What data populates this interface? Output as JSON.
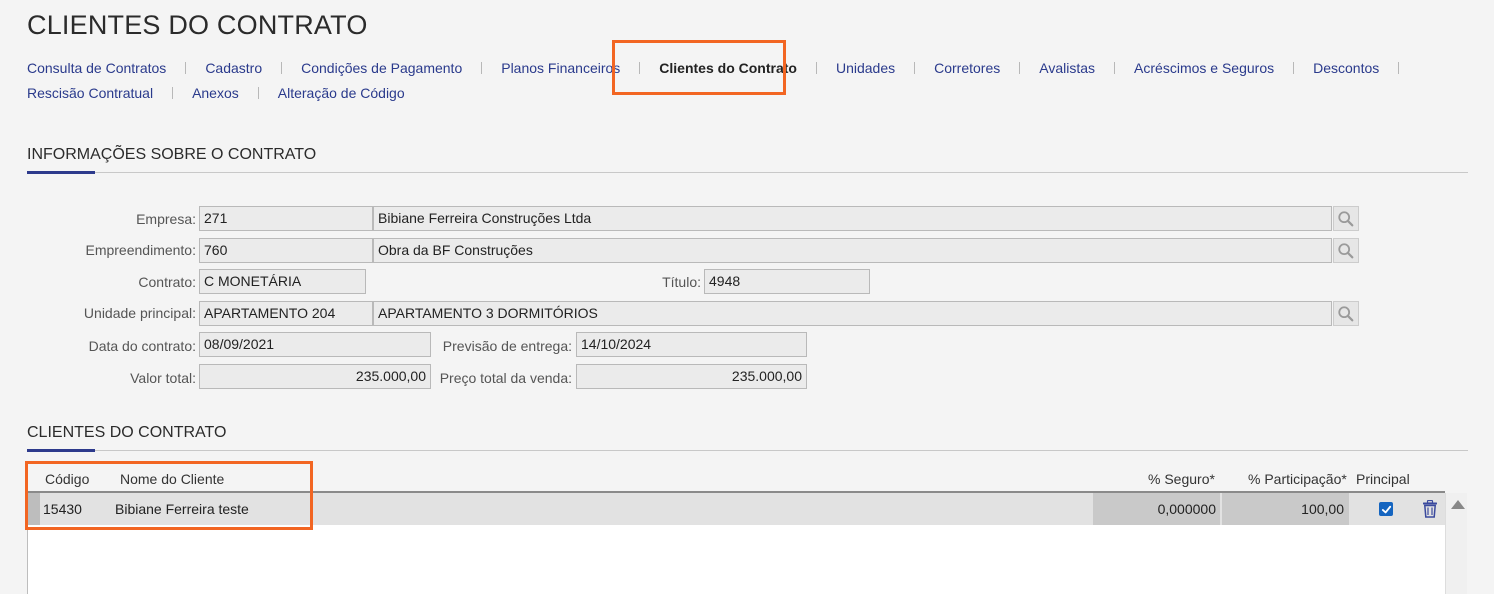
{
  "page": {
    "title": "CLIENTES DO CONTRATO"
  },
  "nav": {
    "row1": [
      "Consulta de Contratos",
      "Cadastro",
      "Condições de Pagamento",
      "Planos Financeiros",
      "Clientes do Contrato",
      "Unidades",
      "Corretores",
      "Avalistas",
      "Acréscimos e Seguros",
      "Descontos"
    ],
    "row2": [
      "Rescisão Contratual",
      "Anexos",
      "Alteração de Código"
    ],
    "active": "Clientes do Contrato"
  },
  "info": {
    "title": "INFORMAÇÕES SOBRE O CONTRATO",
    "empresa": {
      "label": "Empresa:",
      "code": "271",
      "name": "Bibiane Ferreira Construções Ltda"
    },
    "empreendimento": {
      "label": "Empreendimento:",
      "code": "760",
      "name": "Obra da BF Construções"
    },
    "contrato": {
      "label": "Contrato:",
      "value": "C MONETÁRIA"
    },
    "titulo": {
      "label": "Título:",
      "value": "4948"
    },
    "unidade": {
      "label": "Unidade principal:",
      "code": "APARTAMENTO 204",
      "name": "APARTAMENTO 3 DORMITÓRIOS"
    },
    "data_contrato": {
      "label": "Data do contrato:",
      "value": "08/09/2021"
    },
    "previsao": {
      "label": "Previsão de entrega:",
      "value": "14/10/2024"
    },
    "valor_total": {
      "label": "Valor total:",
      "value": "235.000,00"
    },
    "preco_total": {
      "label": "Preço total da venda:",
      "value": "235.000,00"
    }
  },
  "clientes": {
    "title": "CLIENTES DO CONTRATO",
    "columns": {
      "codigo": "Código",
      "nome": "Nome do Cliente",
      "seguro": "% Seguro*",
      "participacao": "% Participação*",
      "principal": "Principal"
    },
    "rows": [
      {
        "codigo": "15430",
        "nome": "Bibiane Ferreira teste",
        "seguro": "0,000000",
        "participacao": "100,00",
        "principal": true
      }
    ]
  },
  "icons": {
    "search": "search-icon",
    "trash": "trash-icon",
    "check": "check-icon",
    "scroll_up": "arrow-up-icon"
  },
  "colors": {
    "accent": "#2d3a8c",
    "link": "#2a3a8c",
    "highlight": "#f26522",
    "checkbox": "#1565c0"
  }
}
